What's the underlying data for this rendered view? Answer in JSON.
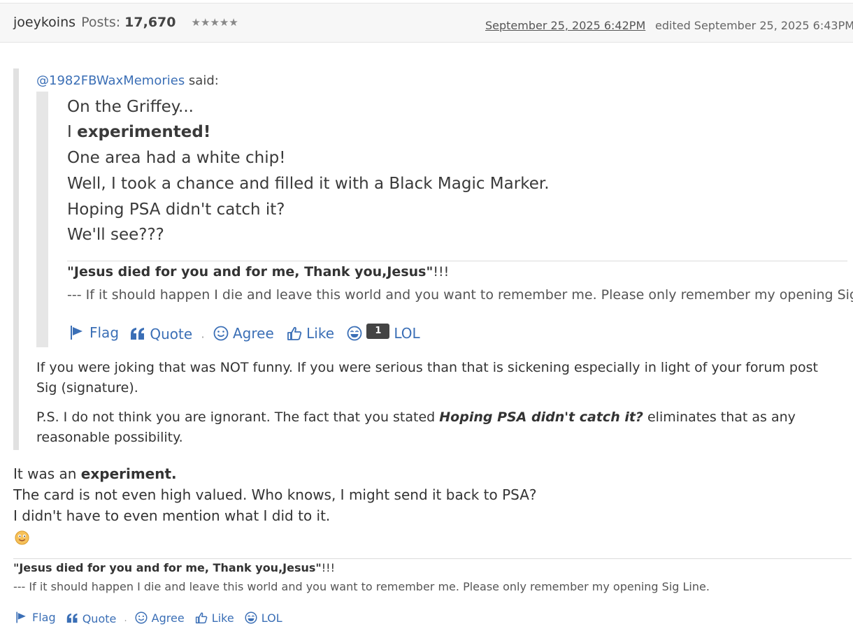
{
  "post": {
    "author": "joeykoins",
    "posts_label": "Posts:",
    "posts_count": "17,670",
    "rank_stars": "★★★★★",
    "date": "September 25, 2025 6:42PM",
    "edited": "edited September 25, 2025 6:43PM"
  },
  "outer_quote": {
    "mention": "@1982FBWaxMemories",
    "said": " said:",
    "inner_quote": {
      "lines": [
        "On the Griffey...",
        "I ",
        "experimented!",
        "One area had a white chip!",
        "Well, I took a chance and filled it with a Black Magic Marker.",
        "Hoping PSA didn't catch it?",
        "We'll see???"
      ],
      "sig_bold": "\"Jesus died for you and for me, Thank you,Jesus\"",
      "sig_tail": "!!!",
      "sig_line2": "--- If it should happen I die and leave this world and you want to remember me. Please only remember my opening Sig Line.",
      "actions": {
        "flag": "Flag",
        "quote": "Quote",
        "dot": "·",
        "agree": "Agree",
        "like": "Like",
        "lol_count": "1",
        "lol": "LOL"
      }
    },
    "reply_p1": "If you were joking that was NOT funny. If you were serious than that is sickening especially in light of your forum post Sig (signature).",
    "reply_p2_start": "P.S. I do not think you are ignorant. The fact that you stated ",
    "reply_p2_emph": "Hoping PSA didn't catch it?",
    "reply_p2_end": " eliminates that as any reasonable possibility."
  },
  "body": {
    "line1_start": "It was an ",
    "line1_bold": "experiment.",
    "line2": "The card is not even high valued. Who knows, I might send it back to PSA?",
    "line3": "I didn't have to even mention what I did to it."
  },
  "signature": {
    "bold": "\"Jesus died for you and for me, Thank you,Jesus\"",
    "tail": "!!!",
    "line2": "--- If it should happen I die and leave this world and you want to remember me. Please only remember my opening Sig Line."
  },
  "actions": {
    "flag": "Flag",
    "quote": "Quote",
    "dot": "·",
    "agree": "Agree",
    "like": "Like",
    "lol": "LOL"
  },
  "colors": {
    "link": "#3b6fb6",
    "badge": "#444444"
  }
}
